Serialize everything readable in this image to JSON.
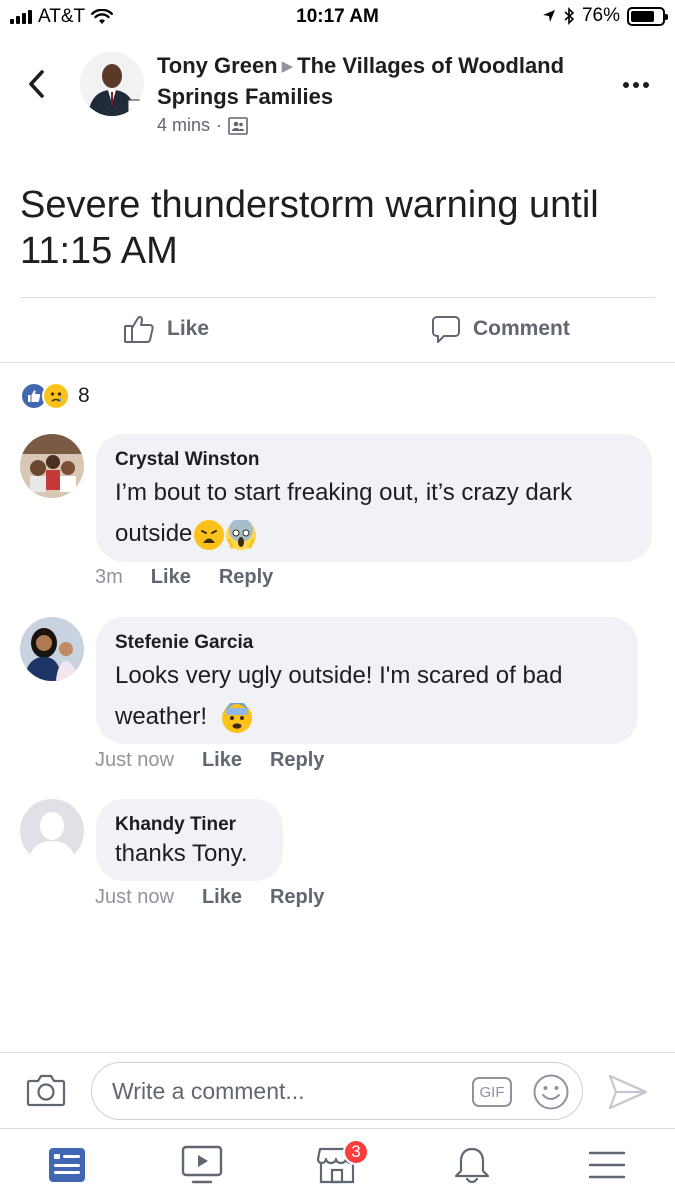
{
  "status_bar": {
    "carrier": "AT&T",
    "time": "10:17 AM",
    "battery": "76%",
    "battery_level": 0.76,
    "signal_bars": 4
  },
  "post": {
    "author": "Tony Green",
    "group": "The Villages of Woodland Springs Families",
    "time": "4 mins",
    "separator": "·",
    "audience_icon": "group-audience-icon",
    "text": "Severe thunderstorm warning until 11:15 AM",
    "actions": {
      "like": "Like",
      "comment": "Comment"
    },
    "reactions": {
      "types": [
        "like",
        "sad"
      ],
      "count": "8"
    }
  },
  "comments": [
    {
      "name": "Crystal Winston",
      "text": "I’m bout to start freaking out, it’s crazy dark outside",
      "emojis": [
        "weary-face",
        "screaming-face"
      ],
      "time": "3m",
      "like": "Like",
      "reply": "Reply"
    },
    {
      "name": "Stefenie Garcia",
      "text_line1": "Looks very ugly outside!  I'm scared of bad",
      "text_line2": "weather!",
      "emojis": [
        "fearful-face"
      ],
      "time": "Just now",
      "like": "Like",
      "reply": "Reply"
    },
    {
      "name": "Khandy Tiner",
      "text": "thanks Tony.",
      "time": "Just now",
      "like": "Like",
      "reply": "Reply"
    }
  ],
  "composer": {
    "placeholder": "Write a comment...",
    "gif_label": "GIF"
  },
  "tab_bar": {
    "tabs": [
      "news-feed",
      "watch",
      "marketplace",
      "notifications",
      "menu"
    ],
    "marketplace_badge": "3"
  },
  "colors": {
    "accent": "#4267b2",
    "text": "#1c1e21",
    "secondary": "#606770",
    "badge": "#fa3e3e",
    "bubble": "#f0f2f5"
  }
}
